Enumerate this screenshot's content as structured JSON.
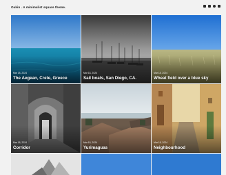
{
  "header": {
    "site_title": "Oakin . A minimalist square theme.",
    "social_icons": [
      "facebook-icon",
      "pinterest-icon",
      "instagram-icon",
      "rss-icon"
    ]
  },
  "posts": [
    {
      "date": "Mar 18, 2024",
      "title": "The Aegean, Crete, Greece"
    },
    {
      "date": "Mar 18, 2024",
      "title": "Sail boats, San Diego, CA."
    },
    {
      "date": "Mar 18, 2024",
      "title": "Wheat field over a blue sky"
    },
    {
      "date": "Mar 18, 2024",
      "title": "Corridor"
    },
    {
      "date": "Mar 18, 2024",
      "title": "Yurimaguas"
    },
    {
      "date": "Mar 18, 2024",
      "title": "Neighbourhood"
    }
  ]
}
